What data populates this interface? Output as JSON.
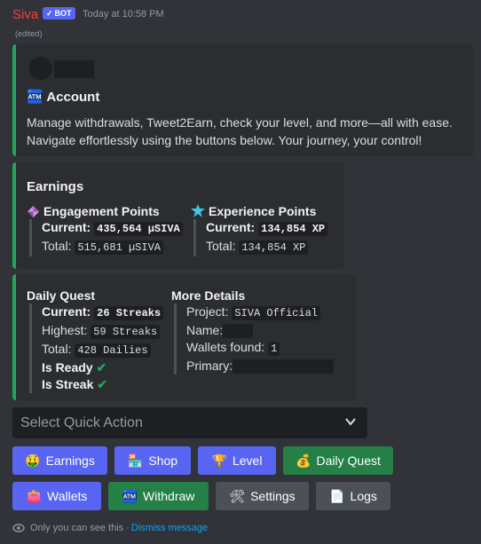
{
  "message": {
    "username": "Siva",
    "bot_tag": "BOT",
    "timestamp": "Today at 10:58 PM",
    "edited": "(edited)"
  },
  "account_embed": {
    "title_emoji": "🏧",
    "title": "Account",
    "description_line1": "Manage withdrawals, Tweet2Earn, check your level, and more—all with ease.",
    "description_line2": "Navigate effortlessly using the buttons below. Your journey, your control!"
  },
  "earnings_embed": {
    "title": "Earnings",
    "engagement": {
      "label": "Engagement Points",
      "current_label": "Current:",
      "current_value": "435,564 µSIVA",
      "total_label": "Total:",
      "total_value": "515,681 µSIVA"
    },
    "experience": {
      "label": "Experience Points",
      "current_label": "Current:",
      "current_value": "134,854 XP",
      "total_label": "Total:",
      "total_value": "134,854 XP"
    }
  },
  "quest_embed": {
    "daily_quest_title": "Daily Quest",
    "current_label": "Current:",
    "current_value": "26 Streaks",
    "highest_label": "Highest:",
    "highest_value": "59 Streaks",
    "total_label": "Total:",
    "total_value": "428 Dailies",
    "is_ready_label": "Is Ready",
    "is_streak_label": "Is Streak",
    "more_details_title": "More Details",
    "project_label": "Project:",
    "project_value": "SIVA Official",
    "name_label": "Name:",
    "wallets_label": "Wallets found:",
    "wallets_value": "1",
    "primary_label": "Primary:"
  },
  "select": {
    "placeholder": "Select Quick Action"
  },
  "buttons": {
    "earnings": "Earnings",
    "shop": "Shop",
    "level": "Level",
    "daily_quest": "Daily Quest",
    "wallets": "Wallets",
    "withdraw": "Withdraw",
    "settings": "Settings",
    "logs": "Logs"
  },
  "footer": {
    "only_you": "Only you can see this ·",
    "dismiss": "Dismiss message"
  },
  "colors": {
    "background": "#313338",
    "embed_bg": "#2b2d31",
    "accent_green": "#23a559",
    "blurple": "#5865f2",
    "green_button": "#248046",
    "grey_button": "#4e5058",
    "username_red": "#f23f43",
    "link": "#00a8fc"
  },
  "icons": {
    "account": "atm-icon",
    "engagement": "purple-gem-icon",
    "experience": "star-burst-icon",
    "check": "check-mark-icon"
  }
}
